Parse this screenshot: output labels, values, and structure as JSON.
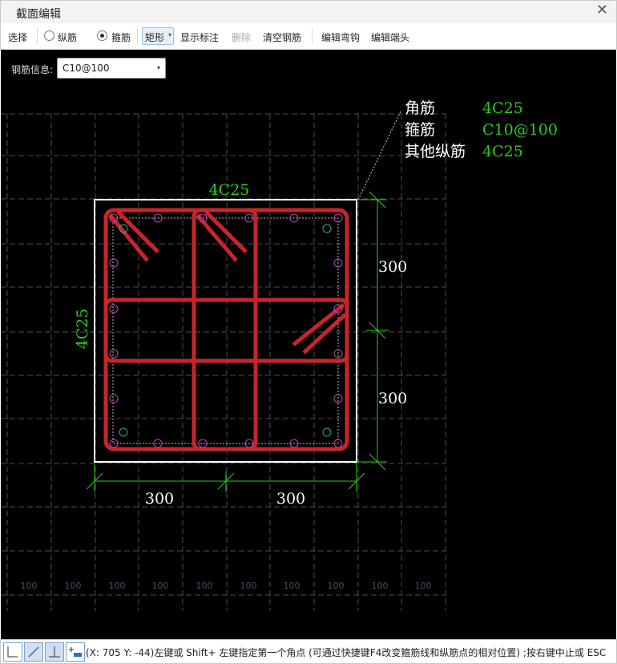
{
  "window": {
    "title": "截面编辑",
    "close_icon": "close-icon"
  },
  "toolbar": {
    "select": "选择",
    "longitudinal": "纵筋",
    "stirrup": "箍筋",
    "rect": "矩形",
    "show_label": "显示标注",
    "delete": "删除",
    "clear": "清空钢筋",
    "edit_hook": "编辑弯钩",
    "edit_end": "编辑端头"
  },
  "info": {
    "label": "钢筋信息:",
    "value": "C10@100"
  },
  "drawing": {
    "legend": [
      {
        "name": "角筋",
        "value": "4C25"
      },
      {
        "name": "箍筋",
        "value": "C10@100"
      },
      {
        "name": "其他纵筋",
        "value": "4C25"
      }
    ],
    "top_label": "4C25",
    "left_label": "4C25",
    "dim_right": [
      "300",
      "300"
    ],
    "dim_bottom": [
      "300",
      "300"
    ],
    "grid_label": "100",
    "colors": {
      "bar": "#c8252b",
      "dim": "#2ecc1f",
      "text": "#ffffff",
      "grid": "#4a4a5e",
      "rebar": "#c040c0"
    }
  },
  "status": {
    "text": "(X: 705 Y: -44)左键或 Shift+ 左键指定第一个角点 (可通过快捷键F4改变箍筋线和纵筋点的相对位置) ;按右键中止或 ESC"
  }
}
